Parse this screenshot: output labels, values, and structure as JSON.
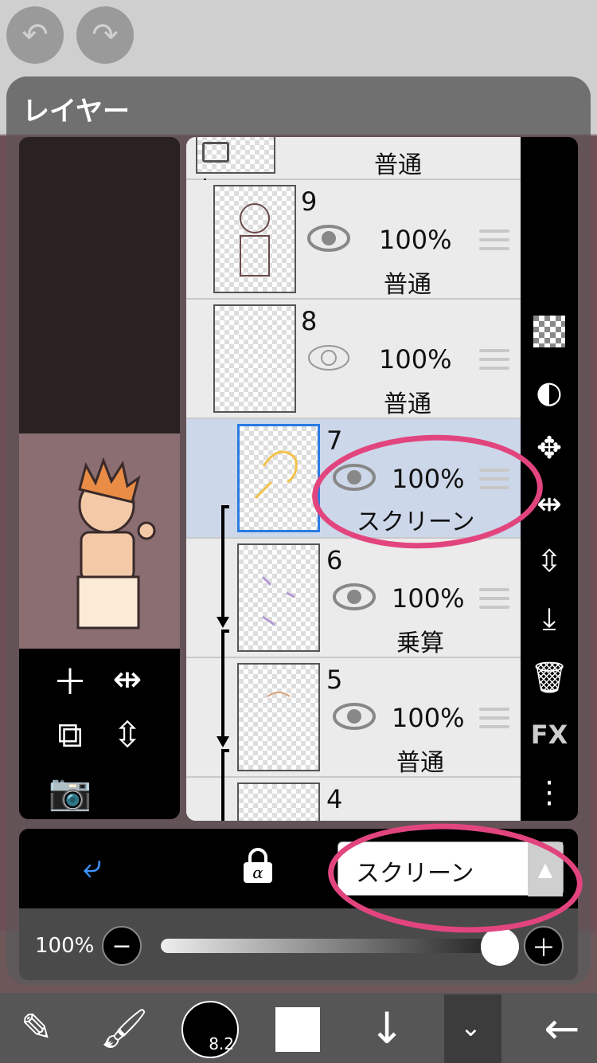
{
  "panel": {
    "title": "レイヤー"
  },
  "layers": [
    {
      "name": "",
      "opacity": "",
      "blend": "普通"
    },
    {
      "name": "9",
      "opacity": "100%",
      "blend": "普通"
    },
    {
      "name": "8",
      "opacity": "100%",
      "blend": "普通"
    },
    {
      "name": "7",
      "opacity": "100%",
      "blend": "スクリーン"
    },
    {
      "name": "6",
      "opacity": "100%",
      "blend": "乗算"
    },
    {
      "name": "5",
      "opacity": "100%",
      "blend": "普通"
    },
    {
      "name": "4",
      "opacity": "",
      "blend": ""
    }
  ],
  "blend_select": {
    "value": "スクリーン"
  },
  "opacity_bar": {
    "label": "100%",
    "value": 1.0
  },
  "toolbar": {
    "brush_size": "8.2"
  },
  "right_tools": {
    "fx_label": "FX"
  },
  "colors": {
    "selection": "#cdd7ea",
    "accent": "#2a7be4",
    "marker": "#e2457e"
  }
}
